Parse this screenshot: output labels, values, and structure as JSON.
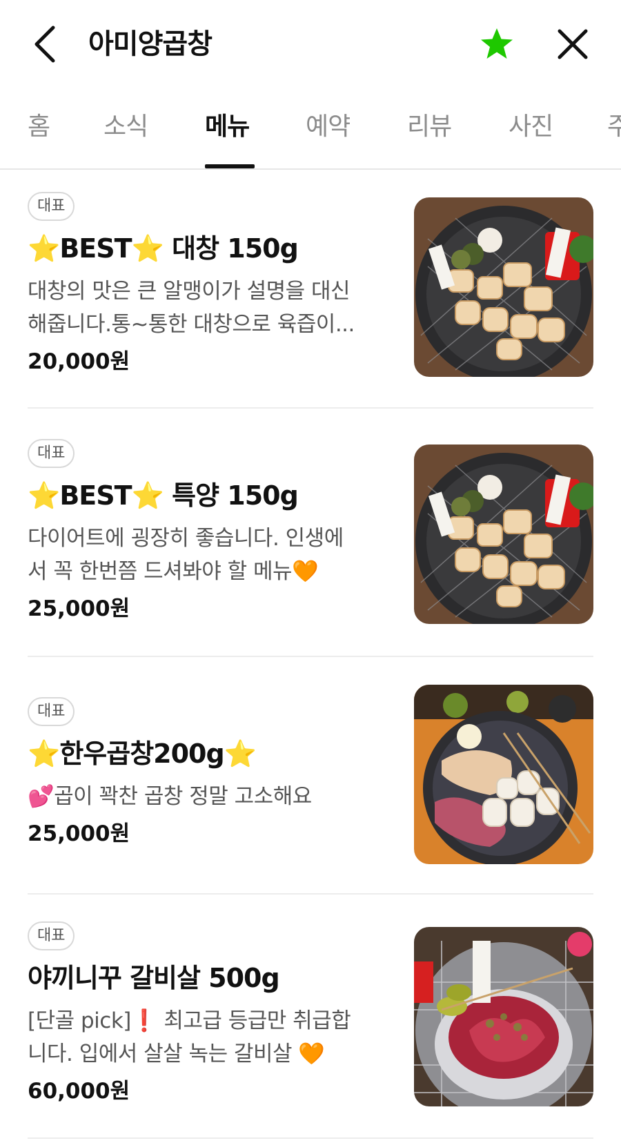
{
  "header": {
    "title": "아미양곱창",
    "back_icon": "chevron-left-icon",
    "favorite_icon": "star-icon",
    "favorite_color": "#1ec800",
    "close_icon": "close-icon"
  },
  "tabs": [
    {
      "label": "홈",
      "active": false
    },
    {
      "label": "소식",
      "active": false
    },
    {
      "label": "메뉴",
      "active": true
    },
    {
      "label": "예약",
      "active": false
    },
    {
      "label": "리뷰",
      "active": false
    },
    {
      "label": "사진",
      "active": false
    },
    {
      "label": "주",
      "active": false
    }
  ],
  "menu": {
    "items": [
      {
        "badge": "대표",
        "name_prefix": "⭐",
        "name_main": "BEST",
        "name_mid": "⭐",
        "name_suffix": " 대창 150g",
        "desc_line1": "대창의 맛은 큰 알맹이가 설명을 대신",
        "desc_line2": "해줍니다.통~통한 대창으로 육즙이...",
        "price": "20,000원"
      },
      {
        "badge": "대표",
        "name_prefix": "⭐",
        "name_main": "BEST",
        "name_mid": "⭐",
        "name_suffix": " 특양 150g",
        "desc_line1": "다이어트에 굉장히 좋습니다. 인생에",
        "desc_line2": "서 꼭 한번쯤 드셔봐야 할 메뉴",
        "desc_emoji": "🧡",
        "price": "25,000원"
      },
      {
        "badge": "대표",
        "name_prefix": "⭐",
        "name_main": "한우곱창200g",
        "name_suffix": "⭐",
        "desc_emoji": "💕",
        "desc_line1": "곱이 꽉찬 곱창 정말 고소해요",
        "price": "25,000원"
      },
      {
        "badge": "대표",
        "name_main": "야끼니꾸 갈비살 500g",
        "desc_line1_a": "[단골 pick]",
        "desc_line1_emoji": "❗",
        "desc_line1_b": " 최고급 등급만 취급합",
        "desc_line2": "니다. 입에서 살살 녹는 갈비살 ",
        "desc_emoji": "🧡",
        "price": "60,000원"
      }
    ]
  }
}
